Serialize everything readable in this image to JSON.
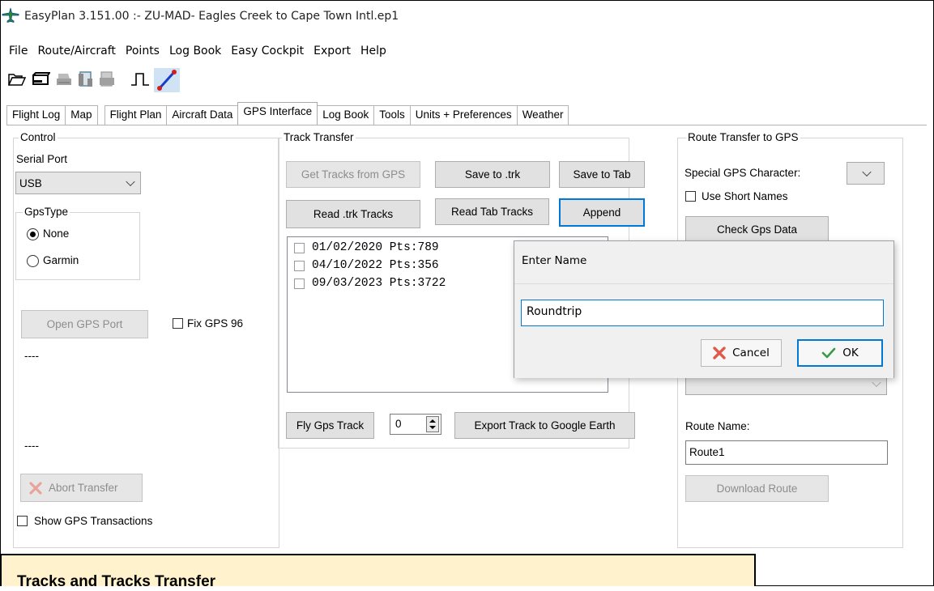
{
  "window": {
    "title": "EasyPlan 3.151.00 :- ZU-MAD- Eagles Creek to Cape Town Intl.ep1",
    "app_icon": "aircraft-icon"
  },
  "menu": [
    "File",
    "Route/Aircraft",
    "Points",
    "Log Book",
    "Easy Cockpit",
    "Export",
    "Help"
  ],
  "toolbar": {
    "icons": [
      "open-folder-icon",
      "save-icon",
      "print-icon",
      "print-preview-icon",
      "profile-icon",
      "route-line-icon"
    ]
  },
  "tabs": [
    "Flight Log",
    "Map",
    "Flight Plan",
    "Aircraft Data",
    "GPS Interface",
    "Log Book",
    "Tools",
    "Units + Preferences",
    "Weather"
  ],
  "active_tab": "GPS Interface",
  "control": {
    "title": "Control",
    "serial_port_label": "Serial Port",
    "serial_port_value": "USB",
    "gps_type_title": "GpsType",
    "radio_none": "None",
    "radio_garmin": "Garmin",
    "open_port": "Open GPS Port",
    "fix_gps": "Fix GPS 96",
    "status1": "----",
    "status2": "----",
    "abort": "Abort Transfer",
    "show_tx": "Show GPS Transactions"
  },
  "track": {
    "title": "Track Transfer",
    "get_tracks": "Get Tracks from GPS",
    "save_trk": "Save to .trk",
    "save_tab": "Save to Tab",
    "read_trk": "Read .trk Tracks",
    "read_tab": "Read Tab Tracks",
    "append": "Append",
    "list": [
      "01/02/2020 Pts:789",
      "04/10/2022 Pts:356",
      "09/03/2023 Pts:3722"
    ],
    "fly": "Fly Gps Track",
    "spin_value": "0",
    "export": "Export Track to Google Earth"
  },
  "route": {
    "title": "Route Transfer to GPS",
    "special_char": "Special GPS Character:",
    "short_names": "Use Short Names",
    "check": "Check Gps Data",
    "route_name_label": "Route Name:",
    "route_name_value": "Route1",
    "download": "Download Route"
  },
  "dialog": {
    "title": "Enter Name",
    "value": "Roundtrip",
    "cancel": "Cancel",
    "ok": "OK"
  },
  "caption": "Tracks and Tracks Transfer",
  "colors": {
    "focus_blue": "#0078d7",
    "caption_bg": "#fff2cc",
    "cancel_red": "#e05a4b",
    "ok_green": "#3a9a48"
  }
}
